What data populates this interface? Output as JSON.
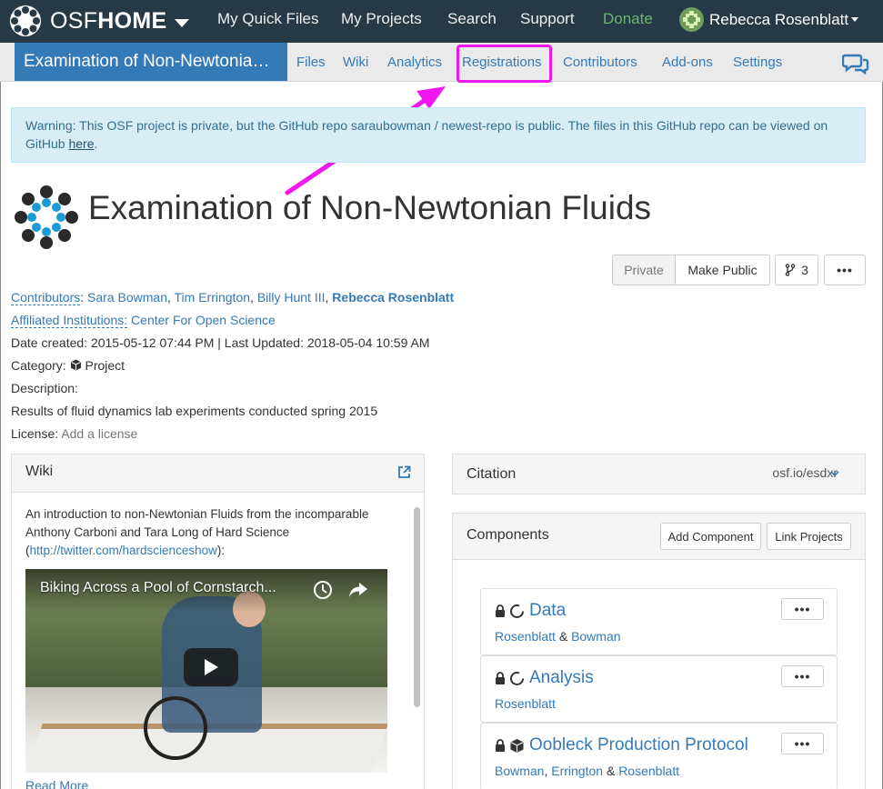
{
  "topbar": {
    "brand_prefix": "OSF",
    "brand_suffix": "HOME",
    "nav": [
      "My Quick Files",
      "My Projects",
      "Search",
      "Support",
      "Donate"
    ],
    "user_name": "Rebecca Rosenblatt",
    "donate_color": "#6bb76b",
    "background": "#263947"
  },
  "project_nav": {
    "title": "Examination of Non-Newtonian Fluids",
    "tabs": [
      "Files",
      "Wiki",
      "Analytics",
      "Registrations",
      "Contributors",
      "Add-ons",
      "Settings"
    ],
    "highlighted_tab": "Registrations",
    "highlight_color": "#f018ee",
    "comments_icon": "comments-icon"
  },
  "alert": {
    "text": "Warning: This OSF project is private, but the GitHub repo saraubowman / newest-repo is public. The files in this GitHub repo can be viewed on GitHub ",
    "link": "here",
    "end": "."
  },
  "project": {
    "title": "Examination of Non-Newtonian Fluids",
    "private_label": "Private",
    "make_public_label": "Make Public",
    "fork_count": "3",
    "more_label": "•••",
    "contributors_label": "Contributors",
    "contributors": [
      "Sara Bowman",
      "Tim Errington",
      "Billy Hunt III",
      "Rebecca Rosenblatt"
    ],
    "institutions_label": "Affiliated Institutions:",
    "institution": "Center For Open Science",
    "dates": "Date created: 2015-05-12 07:44 PM | Last Updated: 2018-05-04 10:59 AM",
    "category_label": "Category:",
    "category": "Project",
    "description_label": "Description:",
    "description": "Results of fluid dynamics lab experiments conducted spring 2015",
    "license_label": "License:",
    "license_value": "Add a license"
  },
  "wiki": {
    "title": "Wiki",
    "text_before": "An introduction to non-Newtonian Fluids from the incomparable Anthony Carboni and Tara Long of Hard Science (",
    "link": "http://twitter.com/hardscienceshow",
    "text_after": "):",
    "video_title": "Biking Across a Pool of Cornstarch...",
    "read_more": "Read More"
  },
  "citation": {
    "title": "Citation",
    "url": "osf.io/esdxr"
  },
  "components": {
    "title": "Components",
    "add_label": "Add Component",
    "link_label": "Link Projects",
    "items": [
      {
        "title": "Data",
        "contributors": [
          "Rosenblatt",
          "Bowman"
        ],
        "separators": [
          " & "
        ]
      },
      {
        "title": "Analysis",
        "contributors": [
          "Rosenblatt"
        ],
        "separators": []
      },
      {
        "title": "Oobleck Production Protocol",
        "contributors": [
          "Bowman",
          "Errington",
          "Rosenblatt"
        ],
        "separators": [
          ", ",
          " & "
        ]
      }
    ]
  }
}
